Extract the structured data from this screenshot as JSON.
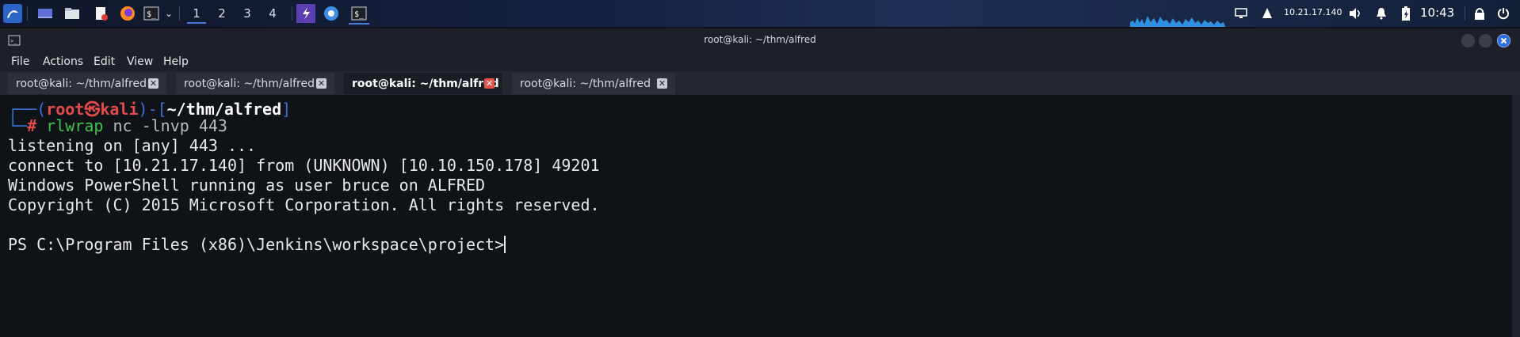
{
  "panel": {
    "workspaces": [
      "1",
      "2",
      "3",
      "4"
    ],
    "ip": "10.21.17.140",
    "clock": "10:43",
    "icons": [
      "kali-menu-icon",
      "desktop-icon",
      "file-manager-icon",
      "text-editor-icon",
      "firefox-icon",
      "terminal-icon",
      "dropdown-icon",
      "burp-icon",
      "chromium-icon",
      "terminal-icon",
      "display-icon",
      "network-icon",
      "volume-icon",
      "notification-icon",
      "battery-icon",
      "lock-icon",
      "logout-icon"
    ]
  },
  "window": {
    "title": "root@kali: ~/thm/alfred",
    "menu": [
      "File",
      "Actions",
      "Edit",
      "View",
      "Help"
    ],
    "tabs": [
      {
        "label": "root@kali: ~/thm/alfred",
        "active": false
      },
      {
        "label": "root@kali: ~/thm/alfred",
        "active": false
      },
      {
        "label": "root@kali: ~/thm/alfred",
        "active": true
      },
      {
        "label": "root@kali: ~/thm/alfred",
        "active": false
      }
    ]
  },
  "terminal": {
    "prompt_user": "root",
    "prompt_skull": "㉿",
    "prompt_host": "kali",
    "prompt_dir": "~/thm/alfred",
    "prompt_hash": "#",
    "cmd_name": "rlwrap",
    "cmd_rest": " nc -lnvp 443",
    "out1": "listening on [any] 443 ...",
    "out2": "connect to [10.21.17.140] from (UNKNOWN) [10.10.150.178] 49201",
    "out3": "Windows PowerShell running as user bruce on ALFRED",
    "out4": "Copyright (C) 2015 Microsoft Corporation. All rights reserved.",
    "ps_prompt": "PS C:\\Program Files (x86)\\Jenkins\\workspace\\project>"
  },
  "colors": {
    "accent": "#3b6fd8",
    "prompt_red": "#e34b4b",
    "cmd_green": "#3ec24a",
    "close_red": "#e0544a"
  }
}
